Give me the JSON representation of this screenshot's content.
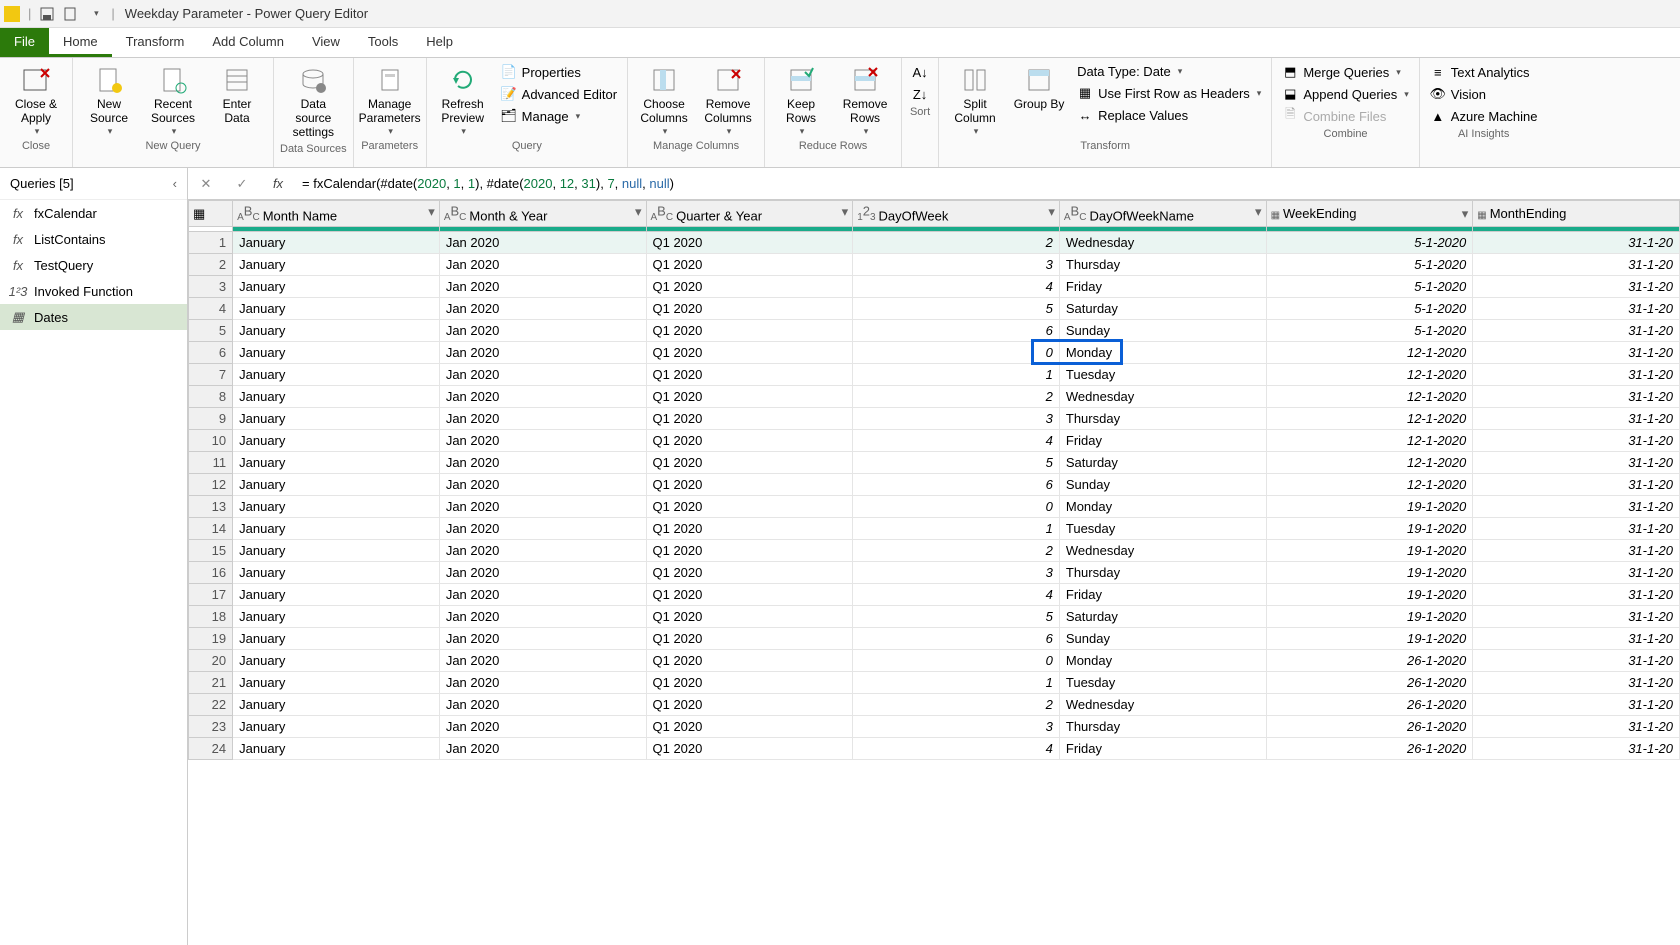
{
  "titlebar": {
    "title": "Weekday Parameter - Power Query Editor"
  },
  "tabs": {
    "file": "File",
    "home": "Home",
    "transform": "Transform",
    "addcolumn": "Add Column",
    "view": "View",
    "tools": "Tools",
    "help": "Help"
  },
  "ribbon": {
    "close": {
      "closeapply": "Close & Apply",
      "group": "Close"
    },
    "newquery": {
      "newsource": "New Source",
      "recent": "Recent Sources",
      "enter": "Enter Data",
      "group": "New Query"
    },
    "datasources": {
      "settings": "Data source settings",
      "group": "Data Sources"
    },
    "parameters": {
      "manage": "Manage Parameters",
      "group": "Parameters"
    },
    "query": {
      "refresh": "Refresh Preview",
      "properties": "Properties",
      "advanced": "Advanced Editor",
      "managebtn": "Manage",
      "group": "Query"
    },
    "managecols": {
      "choose": "Choose Columns",
      "remove": "Remove Columns",
      "group": "Manage Columns"
    },
    "reducerows": {
      "keep": "Keep Rows",
      "removerows": "Remove Rows",
      "group": "Reduce Rows"
    },
    "sort": {
      "group": "Sort"
    },
    "transform": {
      "split": "Split Column",
      "groupby": "Group By",
      "datatype": "Data Type: Date",
      "firstrow": "Use First Row as Headers",
      "replace": "Replace Values",
      "group": "Transform"
    },
    "combine": {
      "merge": "Merge Queries",
      "append": "Append Queries",
      "combinefiles": "Combine Files",
      "group": "Combine"
    },
    "ai": {
      "text": "Text Analytics",
      "vision": "Vision",
      "azure": "Azure Machine",
      "group": "AI Insights"
    }
  },
  "sidebar": {
    "header": "Queries [5]",
    "items": [
      {
        "name": "fxCalendar",
        "icon": "fx"
      },
      {
        "name": "ListContains",
        "icon": "fx"
      },
      {
        "name": "TestQuery",
        "icon": "fx"
      },
      {
        "name": "Invoked Function",
        "icon": "123"
      },
      {
        "name": "Dates",
        "icon": "table",
        "selected": true
      }
    ]
  },
  "formula": {
    "prefix": "= fxCalendar(#date(",
    "y1": "2020",
    "m1": "1",
    "d1": "1",
    "mid": "), #date(",
    "y2": "2020",
    "m2": "12",
    "d2": "31",
    "tail1": "), ",
    "seven": "7",
    "tail2": ", ",
    "n1": "null",
    "tail3": ", ",
    "n2": "null",
    "tail4": ")"
  },
  "columns": {
    "month": "Month Name",
    "monthyear": "Month & Year",
    "qy": "Quarter & Year",
    "dow": "DayOfWeek",
    "down": "DayOfWeekName",
    "we": "WeekEnding",
    "me": "MonthEnding"
  },
  "coltypes": {
    "text": "ABC",
    "num": "123",
    "date": "📅"
  },
  "rows": [
    {
      "n": 1,
      "m": "January",
      "my": "Jan 2020",
      "qy": "Q1 2020",
      "dow": 2,
      "down": "Wednesday",
      "we": "5-1-2020",
      "me": "31-1-20"
    },
    {
      "n": 2,
      "m": "January",
      "my": "Jan 2020",
      "qy": "Q1 2020",
      "dow": 3,
      "down": "Thursday",
      "we": "5-1-2020",
      "me": "31-1-20"
    },
    {
      "n": 3,
      "m": "January",
      "my": "Jan 2020",
      "qy": "Q1 2020",
      "dow": 4,
      "down": "Friday",
      "we": "5-1-2020",
      "me": "31-1-20"
    },
    {
      "n": 4,
      "m": "January",
      "my": "Jan 2020",
      "qy": "Q1 2020",
      "dow": 5,
      "down": "Saturday",
      "we": "5-1-2020",
      "me": "31-1-20"
    },
    {
      "n": 5,
      "m": "January",
      "my": "Jan 2020",
      "qy": "Q1 2020",
      "dow": 6,
      "down": "Sunday",
      "we": "5-1-2020",
      "me": "31-1-20"
    },
    {
      "n": 6,
      "m": "January",
      "my": "Jan 2020",
      "qy": "Q1 2020",
      "dow": 0,
      "down": "Monday",
      "we": "12-1-2020",
      "me": "31-1-20"
    },
    {
      "n": 7,
      "m": "January",
      "my": "Jan 2020",
      "qy": "Q1 2020",
      "dow": 1,
      "down": "Tuesday",
      "we": "12-1-2020",
      "me": "31-1-20"
    },
    {
      "n": 8,
      "m": "January",
      "my": "Jan 2020",
      "qy": "Q1 2020",
      "dow": 2,
      "down": "Wednesday",
      "we": "12-1-2020",
      "me": "31-1-20"
    },
    {
      "n": 9,
      "m": "January",
      "my": "Jan 2020",
      "qy": "Q1 2020",
      "dow": 3,
      "down": "Thursday",
      "we": "12-1-2020",
      "me": "31-1-20"
    },
    {
      "n": 10,
      "m": "January",
      "my": "Jan 2020",
      "qy": "Q1 2020",
      "dow": 4,
      "down": "Friday",
      "we": "12-1-2020",
      "me": "31-1-20"
    },
    {
      "n": 11,
      "m": "January",
      "my": "Jan 2020",
      "qy": "Q1 2020",
      "dow": 5,
      "down": "Saturday",
      "we": "12-1-2020",
      "me": "31-1-20"
    },
    {
      "n": 12,
      "m": "January",
      "my": "Jan 2020",
      "qy": "Q1 2020",
      "dow": 6,
      "down": "Sunday",
      "we": "12-1-2020",
      "me": "31-1-20"
    },
    {
      "n": 13,
      "m": "January",
      "my": "Jan 2020",
      "qy": "Q1 2020",
      "dow": 0,
      "down": "Monday",
      "we": "19-1-2020",
      "me": "31-1-20"
    },
    {
      "n": 14,
      "m": "January",
      "my": "Jan 2020",
      "qy": "Q1 2020",
      "dow": 1,
      "down": "Tuesday",
      "we": "19-1-2020",
      "me": "31-1-20"
    },
    {
      "n": 15,
      "m": "January",
      "my": "Jan 2020",
      "qy": "Q1 2020",
      "dow": 2,
      "down": "Wednesday",
      "we": "19-1-2020",
      "me": "31-1-20"
    },
    {
      "n": 16,
      "m": "January",
      "my": "Jan 2020",
      "qy": "Q1 2020",
      "dow": 3,
      "down": "Thursday",
      "we": "19-1-2020",
      "me": "31-1-20"
    },
    {
      "n": 17,
      "m": "January",
      "my": "Jan 2020",
      "qy": "Q1 2020",
      "dow": 4,
      "down": "Friday",
      "we": "19-1-2020",
      "me": "31-1-20"
    },
    {
      "n": 18,
      "m": "January",
      "my": "Jan 2020",
      "qy": "Q1 2020",
      "dow": 5,
      "down": "Saturday",
      "we": "19-1-2020",
      "me": "31-1-20"
    },
    {
      "n": 19,
      "m": "January",
      "my": "Jan 2020",
      "qy": "Q1 2020",
      "dow": 6,
      "down": "Sunday",
      "we": "19-1-2020",
      "me": "31-1-20"
    },
    {
      "n": 20,
      "m": "January",
      "my": "Jan 2020",
      "qy": "Q1 2020",
      "dow": 0,
      "down": "Monday",
      "we": "26-1-2020",
      "me": "31-1-20"
    },
    {
      "n": 21,
      "m": "January",
      "my": "Jan 2020",
      "qy": "Q1 2020",
      "dow": 1,
      "down": "Tuesday",
      "we": "26-1-2020",
      "me": "31-1-20"
    },
    {
      "n": 22,
      "m": "January",
      "my": "Jan 2020",
      "qy": "Q1 2020",
      "dow": 2,
      "down": "Wednesday",
      "we": "26-1-2020",
      "me": "31-1-20"
    },
    {
      "n": 23,
      "m": "January",
      "my": "Jan 2020",
      "qy": "Q1 2020",
      "dow": 3,
      "down": "Thursday",
      "we": "26-1-2020",
      "me": "31-1-20"
    },
    {
      "n": 24,
      "m": "January",
      "my": "Jan 2020",
      "qy": "Q1 2020",
      "dow": 4,
      "down": "Friday",
      "we": "26-1-2020",
      "me": "31-1-20"
    }
  ]
}
